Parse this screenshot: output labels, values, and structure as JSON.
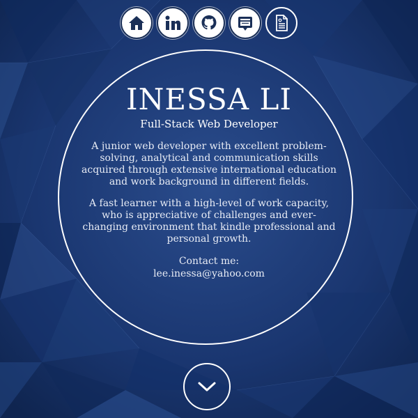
{
  "nav": {
    "items": [
      {
        "icon": "home-icon"
      },
      {
        "icon": "linkedin-icon"
      },
      {
        "icon": "github-icon"
      },
      {
        "icon": "contact-card-icon"
      },
      {
        "icon": "resume-document-icon"
      }
    ]
  },
  "profile": {
    "name": "INESSA LI",
    "title": "Full-Stack Web Developer",
    "paragraph_1": "A junior web developer with excellent problem-solving, analytical and communication skills acquired through extensive international education and work background in different fields.",
    "paragraph_2": "A fast learner with a high-level of work capacity, who is appreciative of challenges and ever-changing environment that kindle professional and personal growth.",
    "contact_label": "Contact me:",
    "contact_email": "lee.inessa@yahoo.com"
  },
  "scroll": {
    "icon": "chevron-down-icon"
  },
  "colors": {
    "background": "#15305f",
    "accent": "#ffffff"
  }
}
